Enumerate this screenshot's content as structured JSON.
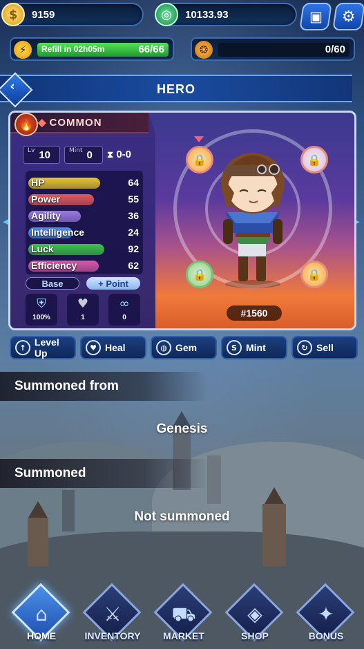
{
  "currency": {
    "gold_value": "9159",
    "token_value": "10133.93"
  },
  "energy": {
    "refill_label": "Refill in 02h05m",
    "count": "66/66",
    "fill_fraction": 1.0
  },
  "secondary_bar": {
    "count": "0/60",
    "fill_fraction": 0.0
  },
  "header": {
    "title": "HERO",
    "back_icon": "arrow-left-icon"
  },
  "hero": {
    "rarity": "COMMON",
    "level_label": "Lv",
    "level": "10",
    "mint_label": "Mint",
    "mint": "0",
    "timer": "0-0",
    "id": "#1560",
    "stats": [
      {
        "name": "HP",
        "value": "64",
        "color": "#e8c52a"
      },
      {
        "name": "Power",
        "value": "55",
        "color": "#e25a5a"
      },
      {
        "name": "Agility",
        "value": "36",
        "color": "#9a7ae0"
      },
      {
        "name": "Intelligence",
        "value": "24",
        "color": "#4f8fe8"
      },
      {
        "name": "Luck",
        "value": "92",
        "color": "#3fc24a"
      },
      {
        "name": "Efficiency",
        "value": "62",
        "color": "#d75aa8"
      }
    ],
    "tabs": {
      "base": "Base",
      "point": "+ Point"
    },
    "mini": [
      {
        "icon": "shield-icon",
        "value": "100%"
      },
      {
        "icon": "heart-icon",
        "value": "1"
      },
      {
        "icon": "infinity-icon",
        "value": "0"
      }
    ]
  },
  "actions": [
    {
      "label": "Level Up",
      "icon": "arrow-up-icon"
    },
    {
      "label": "Heal",
      "icon": "heartbeat-icon"
    },
    {
      "label": "Gem",
      "icon": "globe-icon"
    },
    {
      "label": "Mint",
      "icon": "mint-icon"
    },
    {
      "label": "Sell",
      "icon": "refresh-icon"
    }
  ],
  "sections": {
    "summoned_from_label": "Summoned from",
    "summoned_from_value": "Genesis",
    "summoned_label": "Summoned",
    "summoned_value": "Not summoned"
  },
  "nav": [
    {
      "label": "HOME",
      "icon": "castle-icon",
      "active": true
    },
    {
      "label": "INVENTORY",
      "icon": "crossed-swords-icon",
      "active": false
    },
    {
      "label": "MARKET",
      "icon": "cart-icon",
      "active": false
    },
    {
      "label": "SHOP",
      "icon": "crystal-icon",
      "active": false
    },
    {
      "label": "BONUS",
      "icon": "bonus-icon",
      "active": false
    }
  ]
}
